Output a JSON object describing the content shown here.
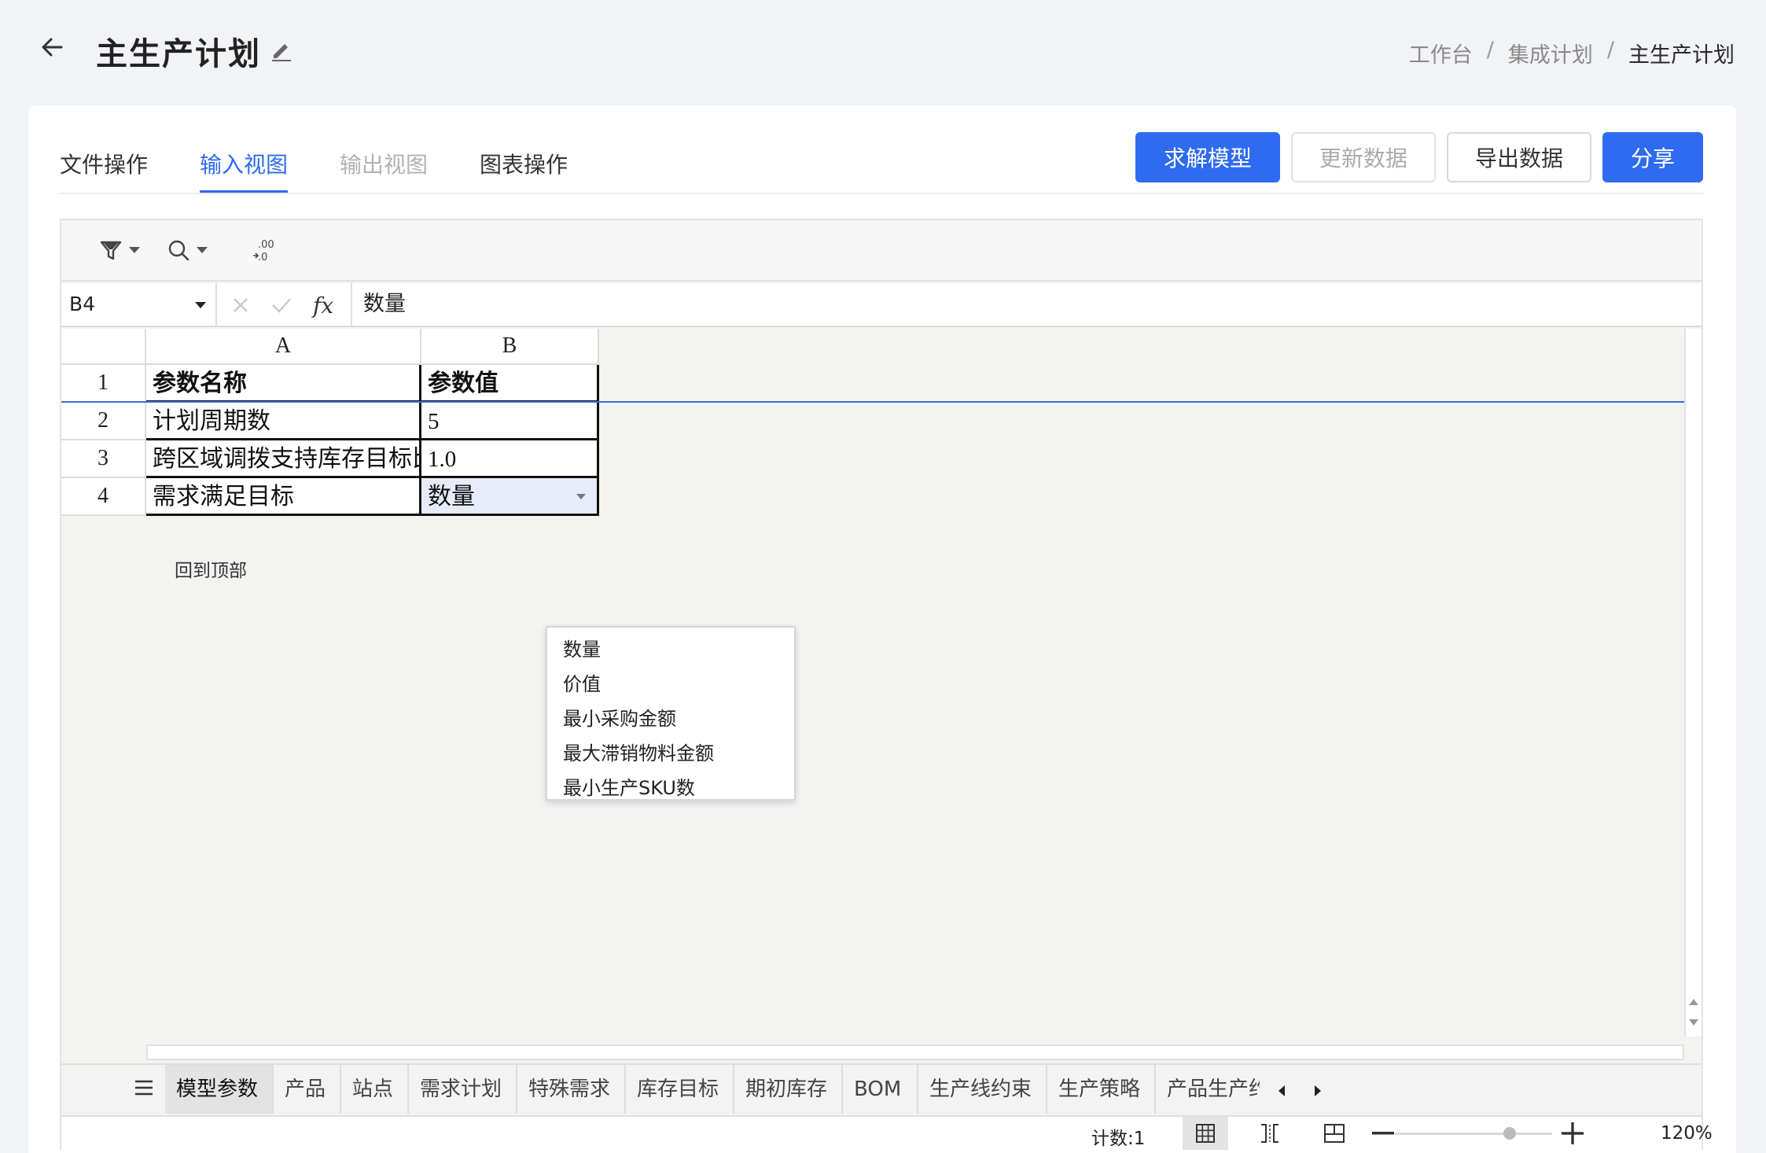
{
  "header": {
    "title": "主生产计划",
    "breadcrumbs": [
      "工作台",
      "集成计划",
      "主生产计划"
    ],
    "breadcrumb_sep": "/"
  },
  "tabs": [
    {
      "label": "文件操作",
      "state": "normal"
    },
    {
      "label": "输入视图",
      "state": "active"
    },
    {
      "label": "输出视图",
      "state": "disabled"
    },
    {
      "label": "图表操作",
      "state": "normal"
    }
  ],
  "actions": {
    "solve": "求解模型",
    "update": "更新数据",
    "export": "导出数据",
    "share": "分享"
  },
  "formula_bar": {
    "cell_ref": "B4",
    "fx_label": "fx",
    "value": "数量"
  },
  "grid": {
    "columns": [
      "A",
      "B"
    ],
    "rows": [
      "1",
      "2",
      "3",
      "4"
    ],
    "cells": [
      [
        "参数名称",
        "参数值"
      ],
      [
        "计划周期数",
        "5"
      ],
      [
        "跨区域调拨支持库存目标比例",
        "1.0"
      ],
      [
        "需求满足目标",
        "数量"
      ]
    ],
    "back_to_top": "回到顶部"
  },
  "dropdown_options": [
    "数量",
    "价值",
    "最小采购金额",
    "最大滞销物料金额",
    "最小生产SKU数"
  ],
  "sheet_tabs": [
    "模型参数",
    "产品",
    "站点",
    "需求计划",
    "特殊需求",
    "库存目标",
    "期初库存",
    "BOM",
    "生产线约束",
    "生产策略",
    "产品生产约"
  ],
  "active_sheet": "模型参数",
  "status_bar": {
    "count": "计数:1",
    "zoom": "120%"
  },
  "colors": {
    "primary": "#2f6bf0",
    "selection": "#e7ecf8",
    "frozen_line": "#3b6fd8"
  }
}
